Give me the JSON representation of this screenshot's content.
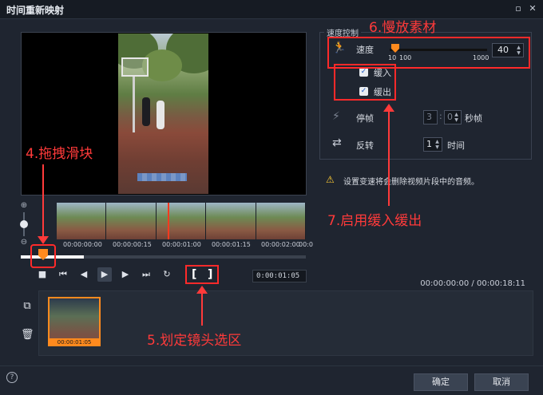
{
  "window": {
    "title": "时间重新映射",
    "minimize": "▫",
    "close": "✕"
  },
  "timeline": {
    "timecodes": [
      "00:00:00:00",
      "00:00:00:15",
      "00:00:01:00",
      "00:00:01:15",
      "00:00:02:00",
      "00:0"
    ],
    "scrub_progress": 0.22,
    "current_timecode": "0:00:01:05",
    "position_display": "00:00:00:00 / 00:00:18:11"
  },
  "speed_panel": {
    "group_title": "速度控制",
    "speed_label": "速度",
    "speed_value": "40",
    "scale_min_a": "10",
    "scale_min_b": "100",
    "scale_max": "1000",
    "ease_in_label": "缓入",
    "ease_out_label": "缓出",
    "freeze_label": "停帧",
    "freeze_seconds": "3",
    "freeze_frames": "0",
    "freeze_unit": "秒帧",
    "reverse_label": "反转",
    "reverse_times": "1",
    "reverse_unit": "时间",
    "warning": "设置变速将会删除视频片段中的音频。"
  },
  "clip": {
    "timecode": "00:00:01:05"
  },
  "annotations": {
    "a4": "4.拖拽滑块",
    "a5": "5.划定镜头选区",
    "a6": "6.慢放素材",
    "a7": "7.启用缓入缓出"
  },
  "buttons": {
    "ok": "确定",
    "cancel": "取消",
    "help": "?"
  },
  "colors": {
    "accent": "#ff8a1e",
    "annotation": "#ff2a2a",
    "icon_blue": "#5aa3ff"
  }
}
